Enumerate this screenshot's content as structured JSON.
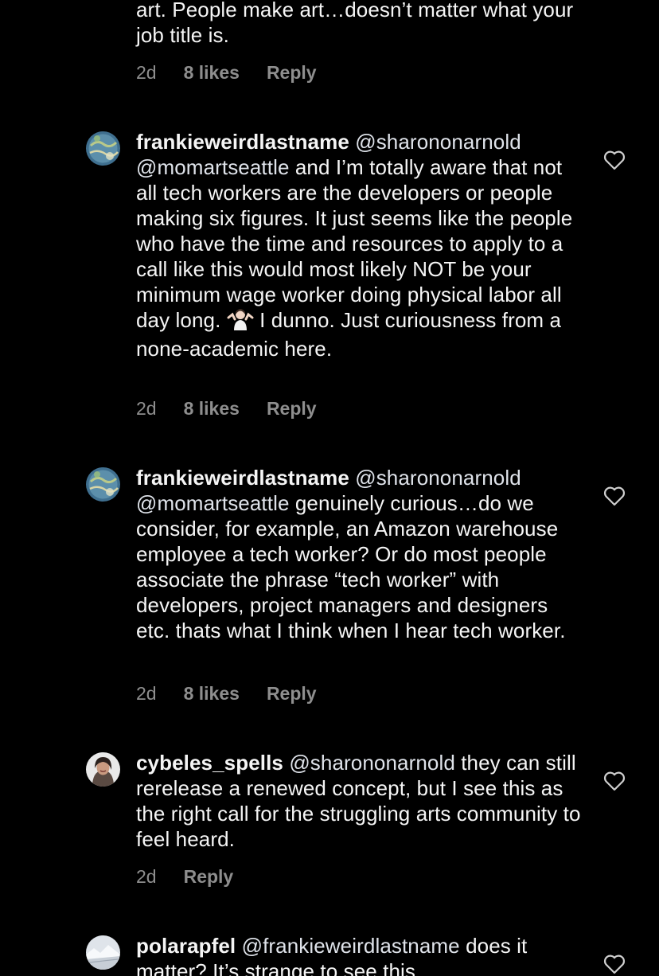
{
  "prev_comment": {
    "text": "art. People make art…doesn’t matter what your job title is.",
    "time": "2d",
    "likes": "8 likes",
    "reply": "Reply"
  },
  "comments": [
    {
      "username": "frankieweirdlastname",
      "mention1": "@sharononarnold",
      "mention2": "@momartseattle",
      "text_a": " and I’m totally aware that not all tech workers are the developers or people making six figures. It just seems like the people who have the time and resources to apply to a call like this would most likely NOT be your minimum wage worker doing physical labor all day long.",
      "emoji_name": "person-shrugging-emoji",
      "text_b": " I dunno. Just curiousness from a none-academic here.",
      "time": "2d",
      "likes": "8 likes",
      "reply": "Reply",
      "avatar_icon": "globe-avatar"
    },
    {
      "username": "frankieweirdlastname",
      "mention1": "@sharononarnold",
      "mention2": "@momartseattle",
      "text_a": " genuinely curious…do we consider, for example, an Amazon warehouse employee a tech worker? Or do most people associate the phrase “tech worker” with developers, project managers and designers etc. thats what I think when I hear tech worker.",
      "time": "2d",
      "likes": "8 likes",
      "reply": "Reply",
      "avatar_icon": "globe-avatar"
    },
    {
      "username": "cybeles_spells",
      "mention1": "@sharononarnold",
      "text_a": " they can still rerelease a renewed concept, but I see this as the right call for the struggling arts community to feel heard.",
      "time": "2d",
      "reply": "Reply",
      "avatar_icon": "portrait-avatar"
    },
    {
      "username": "polarapfel",
      "mention1": "@frankieweirdlastname",
      "text_a": " does it matter? It’s strange to see this",
      "avatar_icon": "snow-landscape-avatar"
    }
  ],
  "icons": {
    "like": "heart-outline-icon"
  },
  "colors": {
    "background": "#000000",
    "text": "#f5f5f5",
    "secondary": "#8e8e8e",
    "mention": "#dfe3ea"
  }
}
